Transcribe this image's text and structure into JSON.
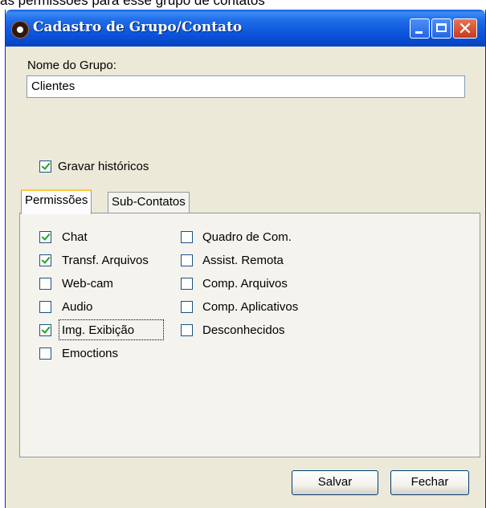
{
  "background_caption": "as permissões para esse grupo de contatos",
  "window": {
    "title": "Cadastro de Grupo/Contato",
    "accent": "#0a52d8"
  },
  "form": {
    "group_name_label": "Nome do Grupo:",
    "group_name_value": "Clientes",
    "save_history_label": "Gravar históricos",
    "save_history_checked": true
  },
  "tabs": [
    {
      "label": "Permissões",
      "active": true
    },
    {
      "label": "Sub-Contatos",
      "active": false
    }
  ],
  "permissions": {
    "left": [
      {
        "label": "Chat",
        "checked": true
      },
      {
        "label": "Transf. Arquivos",
        "checked": true
      },
      {
        "label": "Web-cam",
        "checked": false
      },
      {
        "label": "Audio",
        "checked": false
      },
      {
        "label": "Img. Exibição",
        "checked": true
      },
      {
        "label": "Emoctions",
        "checked": false
      }
    ],
    "right": [
      {
        "label": "Quadro de Com.",
        "checked": false
      },
      {
        "label": "Assist. Remota",
        "checked": false
      },
      {
        "label": "Comp. Arquivos",
        "checked": false
      },
      {
        "label": "Comp. Aplicativos",
        "checked": false
      },
      {
        "label": "Desconhecidos",
        "checked": false
      }
    ]
  },
  "buttons": {
    "save_label": "Salvar",
    "close_label": "Fechar"
  },
  "icons": {
    "app": "app-logo-icon",
    "minimize": "minimize-icon",
    "maximize": "maximize-icon",
    "close": "close-icon"
  }
}
